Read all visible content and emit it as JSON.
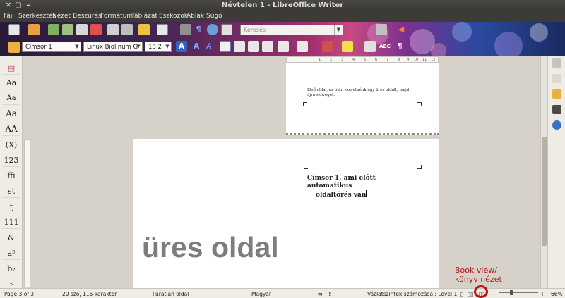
{
  "window": {
    "title": "Névtelen 1 - LibreOffice Writer"
  },
  "menu": [
    "Fájl",
    "Szerkesztés",
    "Nézet",
    "Beszúrás",
    "Formátum",
    "Táblázat",
    "Eszközök",
    "Ablak",
    "Súgó"
  ],
  "toolbar": {
    "search_placeholder": "Keresés",
    "paragraph_style": "Címsor 1",
    "font_name": "Linux Biolinum G",
    "font_size": "18,2"
  },
  "left_panel": {
    "items": [
      "Aa",
      "Aa",
      "Aa",
      "AA",
      "(X)",
      "123",
      "ffi",
      "st",
      "ʈ",
      "111",
      "&",
      "a²",
      "b₂"
    ]
  },
  "document": {
    "page1_text": "Első oldal, ez után szeretnénk egy üres oldalt, majd újra szöveget.",
    "heading_line1": "Címsor 1, ami előtt automatikus",
    "heading_line2": "oldaltörés van",
    "big_text": "üres oldal"
  },
  "ruler_numbers": [
    "1",
    "2",
    "3",
    "4",
    "5",
    "6",
    "7",
    "8",
    "9",
    "10",
    "11",
    "12"
  ],
  "status": {
    "page": "Page 3 of 3",
    "words": "20 szó, 115 karakter",
    "page_style": "Páratlan oldal",
    "language": "Magyar",
    "outline": "Vázlatszintek számozása : Level 1",
    "zoom": "66%"
  },
  "annotation": {
    "line1": "Book view/",
    "line2": "könyv nézet"
  }
}
